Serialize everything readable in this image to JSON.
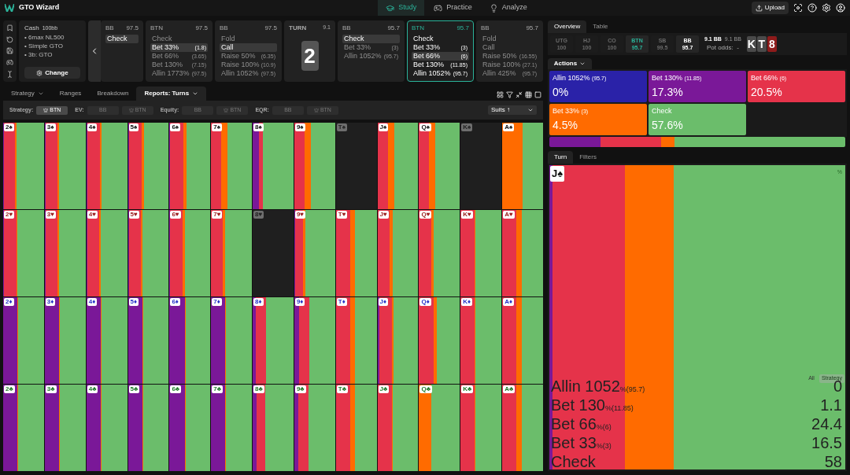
{
  "header": {
    "logo": "GTO Wizard",
    "nav": [
      {
        "label": "Study",
        "selected": true
      },
      {
        "label": "Practice",
        "selected": false
      },
      {
        "label": "Analyze",
        "selected": false
      }
    ],
    "upload": "Upload"
  },
  "game": {
    "title": "Cash",
    "stack": "100bb",
    "bullets": [
      "• 6max NL500",
      "• Simple GTO",
      "• 3b: GTO"
    ],
    "change": "Change"
  },
  "streets": [
    {
      "kind": "actions",
      "player": "BB",
      "stack": "97.5",
      "active": false,
      "back": true,
      "actions": [
        {
          "label": "Check",
          "selected": true
        }
      ]
    },
    {
      "kind": "actions",
      "player": "BTN",
      "stack": "97.5",
      "active": false,
      "back": false,
      "actions": [
        {
          "label": "Check",
          "selected": false
        },
        {
          "label": "Bet 33%",
          "amount": "(1.8)",
          "selected": true
        },
        {
          "label": "Bet 66%",
          "amount": "(3.65)",
          "selected": false
        },
        {
          "label": "Bet 130%",
          "amount": "(7.15)",
          "selected": false
        },
        {
          "label": "Allin 1773%",
          "amount": "(97.5)",
          "selected": false
        }
      ]
    },
    {
      "kind": "actions",
      "player": "BB",
      "stack": "97.5",
      "active": false,
      "back": false,
      "actions": [
        {
          "label": "Fold",
          "selected": false
        },
        {
          "label": "Call",
          "selected": true
        },
        {
          "label": "Raise 50%",
          "amount": "(6.35)",
          "selected": false
        },
        {
          "label": "Raise 100%",
          "amount": "(10.9)",
          "selected": false
        },
        {
          "label": "Allin 1052%",
          "amount": "(97.5)",
          "selected": false
        }
      ]
    },
    {
      "kind": "card",
      "player": "TURN",
      "stack": "9.1",
      "card": "2"
    },
    {
      "kind": "actions",
      "player": "BB",
      "stack": "95.7",
      "active": false,
      "back": false,
      "actions": [
        {
          "label": "Check",
          "selected": true
        },
        {
          "label": "Bet 33%",
          "amount": "(3)",
          "selected": false
        },
        {
          "label": "Allin 1052%",
          "amount": "(95.7)",
          "selected": false
        }
      ]
    },
    {
      "kind": "actions",
      "player": "BTN",
      "stack": "95.7",
      "active": true,
      "back": false,
      "actions": [
        {
          "label": "Check",
          "selected": false
        },
        {
          "label": "Bet 33%",
          "amount": "(3)",
          "selected": false
        },
        {
          "label": "Bet 66%",
          "amount": "(6)",
          "selected": true
        },
        {
          "label": "Bet 130%",
          "amount": "(11.85)",
          "selected": false
        },
        {
          "label": "Allin 1052%",
          "amount": "(95.7)",
          "selected": false
        }
      ]
    },
    {
      "kind": "actions",
      "player": "BB",
      "stack": "95.7",
      "active": false,
      "back": false,
      "actions": [
        {
          "label": "Fold",
          "selected": false
        },
        {
          "label": "Call",
          "selected": false
        },
        {
          "label": "Raise 50%",
          "amount": "(16.55)",
          "selected": false
        },
        {
          "label": "Raise 100%",
          "amount": "(27.1)",
          "selected": false
        },
        {
          "label": "Allin 425%",
          "amount": "(95.7)",
          "selected": false
        }
      ]
    }
  ],
  "tabs": [
    {
      "label": "Strategy",
      "dropdown": true,
      "selected": false
    },
    {
      "label": "Ranges",
      "dropdown": false,
      "selected": false
    },
    {
      "label": "Breakdown",
      "dropdown": false,
      "selected": false
    },
    {
      "label": "Reports: Turns",
      "dropdown": true,
      "selected": true
    }
  ],
  "filters": [
    {
      "label": "Strategy:",
      "options": [
        {
          "label": "BTN",
          "crown": true,
          "selected": true
        }
      ]
    },
    {
      "label": "EV:",
      "options": [
        {
          "label": "BB",
          "crown": false,
          "selected": false
        },
        {
          "label": "BTN",
          "crown": true,
          "selected": false
        }
      ]
    },
    {
      "label": "Equity:",
      "options": [
        {
          "label": "BB",
          "crown": false,
          "selected": false
        },
        {
          "label": "BTN",
          "crown": true,
          "selected": false
        }
      ]
    },
    {
      "label": "EQR:",
      "options": [
        {
          "label": "BB",
          "crown": false,
          "selected": false
        },
        {
          "label": "BTN",
          "crown": true,
          "selected": false
        }
      ]
    }
  ],
  "sort": "Suits ↑",
  "grid": [
    {
      "color": "#111111",
      "cells": [
        {
          "label": "2♠",
          "blocked": false
        },
        {
          "label": "3♠",
          "blocked": false
        },
        {
          "label": "4♠",
          "blocked": false
        },
        {
          "label": "5♠",
          "blocked": false
        },
        {
          "label": "6♠",
          "blocked": false
        },
        {
          "label": "7♠",
          "blocked": false
        },
        {
          "label": "8♠",
          "blocked": false
        },
        {
          "label": "9♠",
          "blocked": false
        },
        {
          "label": "T♠",
          "blocked": true
        },
        {
          "label": "J♠",
          "blocked": false
        },
        {
          "label": "Q♠",
          "blocked": false
        },
        {
          "label": "K♠",
          "blocked": true
        },
        {
          "label": "A♠",
          "blocked": false
        }
      ]
    },
    {
      "color": "#9b1c1c",
      "cells": [
        {
          "label": "2♥",
          "blocked": false
        },
        {
          "label": "3♥",
          "blocked": false
        },
        {
          "label": "4♥",
          "blocked": false
        },
        {
          "label": "5♥",
          "blocked": false
        },
        {
          "label": "6♥",
          "blocked": false
        },
        {
          "label": "7♥",
          "blocked": false
        },
        {
          "label": "8♥",
          "blocked": true
        },
        {
          "label": "9♥",
          "blocked": false
        },
        {
          "label": "T♥",
          "blocked": false
        },
        {
          "label": "J♥",
          "blocked": false
        },
        {
          "label": "Q♥",
          "blocked": false
        },
        {
          "label": "K♥",
          "blocked": false
        },
        {
          "label": "A♥",
          "blocked": false
        }
      ]
    },
    {
      "color": "#2532c8",
      "cells": [
        {
          "label": "2♦",
          "blocked": false
        },
        {
          "label": "3♦",
          "blocked": false
        },
        {
          "label": "4♦",
          "blocked": false
        },
        {
          "label": "5♦",
          "blocked": false
        },
        {
          "label": "6♦",
          "blocked": false
        },
        {
          "label": "7♦",
          "blocked": false
        },
        {
          "label": "8♦",
          "blocked": false
        },
        {
          "label": "9♦",
          "blocked": false
        },
        {
          "label": "T♦",
          "blocked": false
        },
        {
          "label": "J♦",
          "blocked": false
        },
        {
          "label": "Q♦",
          "blocked": false
        },
        {
          "label": "K♦",
          "blocked": false
        },
        {
          "label": "A♦",
          "blocked": false
        }
      ]
    },
    {
      "color": "#1f7a2a",
      "cells": [
        {
          "label": "2♣",
          "blocked": false
        },
        {
          "label": "3♣",
          "blocked": false
        },
        {
          "label": "4♣",
          "blocked": false
        },
        {
          "label": "5♣",
          "blocked": false
        },
        {
          "label": "6♣",
          "blocked": false
        },
        {
          "label": "7♣",
          "blocked": false
        },
        {
          "label": "8♣",
          "blocked": false
        },
        {
          "label": "9♣",
          "blocked": false
        },
        {
          "label": "T♣",
          "blocked": false
        },
        {
          "label": "J♣",
          "blocked": false
        },
        {
          "label": "Q♣",
          "blocked": false
        },
        {
          "label": "K♣",
          "blocked": false
        },
        {
          "label": "A♣",
          "blocked": false
        }
      ]
    }
  ],
  "right": {
    "tabs": [
      {
        "label": "Overview",
        "selected": true
      },
      {
        "label": "Table",
        "selected": false
      }
    ],
    "positions": [
      {
        "name": "UTG",
        "stack": "100",
        "kind": "folded"
      },
      {
        "name": "HJ",
        "stack": "100",
        "kind": "folded"
      },
      {
        "name": "CO",
        "stack": "100",
        "kind": "folded"
      },
      {
        "name": "BTN",
        "stack": "95.7",
        "kind": "active"
      },
      {
        "name": "SB",
        "stack": "99.5",
        "kind": "folded"
      },
      {
        "name": "BB",
        "stack": "95.7",
        "kind": "live"
      }
    ],
    "pot": [
      "9.1 BB",
      "9.1 BB"
    ],
    "pot_odds": "Pot odds:  -",
    "board": [
      {
        "rank": "K",
        "color": "#4a4a4a"
      },
      {
        "rank": "T",
        "color": "#4a4a4a"
      },
      {
        "rank": "8",
        "color": "#8e1b1b"
      }
    ],
    "actions_menu": "Actions",
    "tiles": [
      {
        "label": "Allin 1052%",
        "amount": "(95.7)",
        "share": "0%",
        "color": "#2a22a8"
      },
      {
        "label": "Bet 130%",
        "amount": "(11.85)",
        "share": "17.3%",
        "color": "#7a1898"
      },
      {
        "label": "Bet 66%",
        "amount": "(6)",
        "share": "20.5%",
        "color": "#e5334a"
      },
      {
        "label": "Bet 33%",
        "amount": "(3)",
        "share": "4.5%",
        "color": "#ff6b00"
      },
      {
        "label": "Check",
        "share": "57.6%",
        "color": "#6bbd6b"
      }
    ]
  },
  "detail": {
    "tabs": [
      {
        "label": "Turn",
        "selected": true
      },
      {
        "label": "Filters",
        "selected": false
      }
    ],
    "card": "J♠",
    "unit": "%",
    "toggle": [
      {
        "label": "All",
        "selected": false
      },
      {
        "label": "Strategy",
        "selected": true
      }
    ],
    "stats": [
      {
        "label": "Allin 1052",
        "unit": "%",
        "amount": "(95.7)",
        "value": "0"
      },
      {
        "label": "Bet 130",
        "unit": "%",
        "amount": "(11.85)",
        "value": "1.1",
        "color": "#7a1898"
      },
      {
        "label": "Bet 66",
        "unit": "%",
        "amount": "(6)",
        "value": "24.4",
        "color": "#e5334a"
      },
      {
        "label": "Bet 33",
        "unit": "%",
        "amount": "(3)",
        "value": "16.5",
        "color": "#ff6b00"
      },
      {
        "label": "Check",
        "value": "58",
        "color": "#6bbd6b"
      }
    ]
  }
}
